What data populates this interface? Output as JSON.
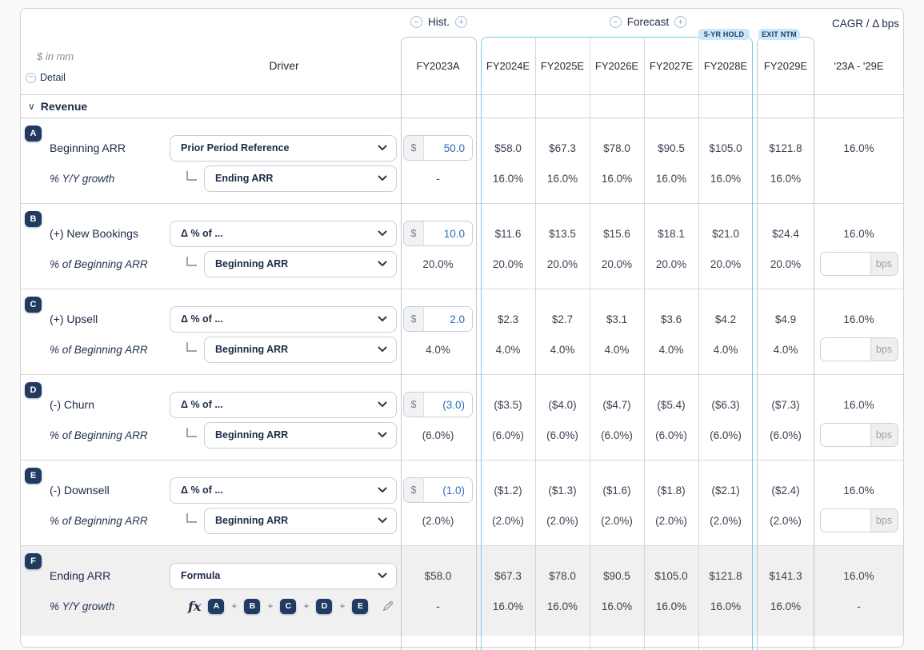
{
  "header": {
    "hist_label": "Hist.",
    "forecast_label": "Forecast",
    "cagr_label": "CAGR / Δ bps",
    "cagr_range": "'23A - '29E",
    "hold_badge": "5-YR HOLD",
    "exit_badge": "EXIT NTM",
    "units_label": "$ in mm",
    "detail_label": "Detail",
    "driver_label": "Driver",
    "columns": [
      "FY2023A",
      "FY2024E",
      "FY2025E",
      "FY2026E",
      "FY2027E",
      "FY2028E",
      "FY2029E"
    ]
  },
  "icons": {
    "minus": "−",
    "plus": "+",
    "section_chevron": "∨"
  },
  "misc": {
    "bps_label": "bps"
  },
  "section": {
    "title": "Revenue"
  },
  "rows": [
    {
      "badge": "A",
      "label": "Beginning ARR",
      "sublabel": "% Y/Y growth",
      "driver": "Prior Period Reference",
      "sub_driver": "Ending ARR",
      "fy2023": {
        "currency": "$",
        "value": "50.0",
        "percent": "-"
      },
      "forecast": [
        "$58.0",
        "$67.3",
        "$78.0",
        "$90.5",
        "$105.0"
      ],
      "forecast_pct": [
        "16.0%",
        "16.0%",
        "16.0%",
        "16.0%",
        "16.0%"
      ],
      "exit": "$121.8",
      "exit_pct": "16.0%",
      "cagr": "16.0%",
      "cagr_sub": ""
    },
    {
      "badge": "B",
      "label": "(+) New Bookings",
      "sublabel": "% of Beginning ARR",
      "driver": "Δ % of ...",
      "sub_driver": "Beginning ARR",
      "fy2023": {
        "currency": "$",
        "value": "10.0",
        "percent": "20.0%"
      },
      "forecast": [
        "$11.6",
        "$13.5",
        "$15.6",
        "$18.1",
        "$21.0"
      ],
      "forecast_pct": [
        "20.0%",
        "20.0%",
        "20.0%",
        "20.0%",
        "20.0%"
      ],
      "exit": "$24.4",
      "exit_pct": "20.0%",
      "cagr": "16.0%"
    },
    {
      "badge": "C",
      "label": "(+) Upsell",
      "sublabel": "% of Beginning ARR",
      "driver": "Δ % of ...",
      "sub_driver": "Beginning ARR",
      "fy2023": {
        "currency": "$",
        "value": "2.0",
        "percent": "4.0%"
      },
      "forecast": [
        "$2.3",
        "$2.7",
        "$3.1",
        "$3.6",
        "$4.2"
      ],
      "forecast_pct": [
        "4.0%",
        "4.0%",
        "4.0%",
        "4.0%",
        "4.0%"
      ],
      "exit": "$4.9",
      "exit_pct": "4.0%",
      "cagr": "16.0%"
    },
    {
      "badge": "D",
      "label": "(-) Churn",
      "sublabel": "% of Beginning ARR",
      "driver": "Δ % of ...",
      "sub_driver": "Beginning ARR",
      "fy2023": {
        "currency": "$",
        "value": "(3.0)",
        "percent": "(6.0%)"
      },
      "forecast": [
        "($3.5)",
        "($4.0)",
        "($4.7)",
        "($5.4)",
        "($6.3)"
      ],
      "forecast_pct": [
        "(6.0%)",
        "(6.0%)",
        "(6.0%)",
        "(6.0%)",
        "(6.0%)"
      ],
      "exit": "($7.3)",
      "exit_pct": "(6.0%)",
      "cagr": "16.0%"
    },
    {
      "badge": "E",
      "label": "(-) Downsell",
      "sublabel": "% of Beginning ARR",
      "driver": "Δ % of ...",
      "sub_driver": "Beginning ARR",
      "fy2023": {
        "currency": "$",
        "value": "(1.0)",
        "percent": "(2.0%)"
      },
      "forecast": [
        "($1.2)",
        "($1.3)",
        "($1.6)",
        "($1.8)",
        "($2.1)"
      ],
      "forecast_pct": [
        "(2.0%)",
        "(2.0%)",
        "(2.0%)",
        "(2.0%)",
        "(2.0%)"
      ],
      "exit": "($2.4)",
      "exit_pct": "(2.0%)",
      "cagr": "16.0%"
    },
    {
      "badge": "F",
      "label": "Ending ARR",
      "sublabel": "% Y/Y growth",
      "driver": "Formula",
      "formula": {
        "fn": "fx",
        "plus": "+",
        "tokens": [
          "A",
          "B",
          "C",
          "D",
          "E"
        ]
      },
      "fy2023": {
        "value": "$58.0",
        "percent": "-"
      },
      "forecast": [
        "$67.3",
        "$78.0",
        "$90.5",
        "$105.0",
        "$121.8"
      ],
      "forecast_pct": [
        "16.0%",
        "16.0%",
        "16.0%",
        "16.0%",
        "16.0%"
      ],
      "exit": "$141.3",
      "exit_pct": "16.0%",
      "cagr": "16.0%",
      "cagr_sub": "-"
    }
  ]
}
